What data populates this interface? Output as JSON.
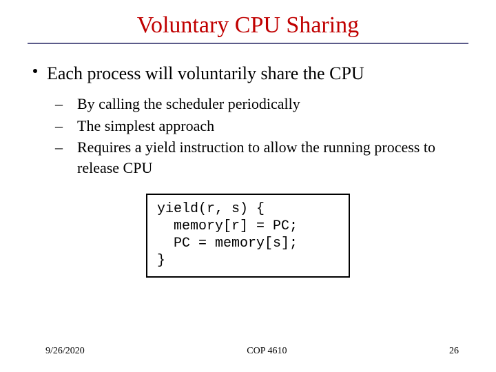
{
  "title": "Voluntary CPU Sharing",
  "bullet": "Each process will voluntarily share the CPU",
  "subs": [
    "By calling the scheduler periodically",
    "The simplest approach",
    "Requires a yield instruction to allow the running process to release CPU"
  ],
  "code": "yield(r, s) {\n  memory[r] = PC;\n  PC = memory[s];\n}",
  "footer": {
    "date": "9/26/2020",
    "course": "COP 4610",
    "page": "26"
  }
}
